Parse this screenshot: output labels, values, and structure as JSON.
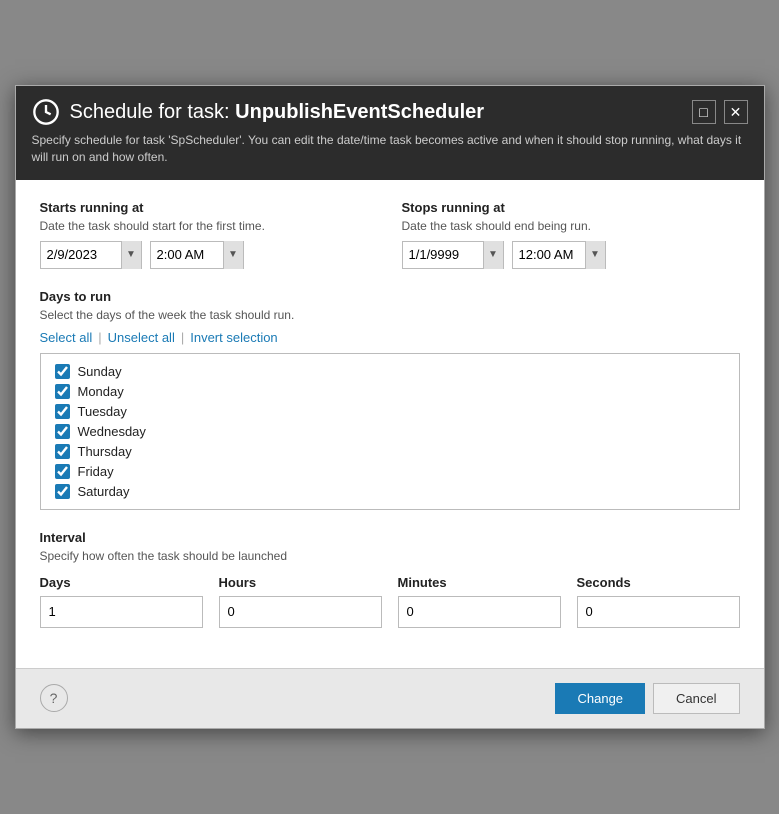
{
  "header": {
    "icon": "clock",
    "title_prefix": "Schedule for task:",
    "task_name": "UnpublishEventScheduler",
    "subtitle": "Specify schedule for task 'SpScheduler'. You can edit the date/time task becomes active and when it should stop running, what days it will run on and how often.",
    "maximize_label": "□",
    "close_label": "✕"
  },
  "starts_running": {
    "label": "Starts running at",
    "desc": "Date the task should start for the first time.",
    "date_value": "2/9/2023",
    "time_value": "2:00 AM"
  },
  "stops_running": {
    "label": "Stops running at",
    "desc": "Date the task should end being run.",
    "date_value": "1/1/9999",
    "time_value": "12:00 AM"
  },
  "days_to_run": {
    "label": "Days to run",
    "desc": "Select the days of the week the task should run.",
    "select_all_label": "Select all",
    "unselect_all_label": "Unselect all",
    "invert_selection_label": "Invert selection",
    "days": [
      {
        "id": "sunday",
        "label": "Sunday",
        "checked": true
      },
      {
        "id": "monday",
        "label": "Monday",
        "checked": true
      },
      {
        "id": "tuesday",
        "label": "Tuesday",
        "checked": true
      },
      {
        "id": "wednesday",
        "label": "Wednesday",
        "checked": true
      },
      {
        "id": "thursday",
        "label": "Thursday",
        "checked": true
      },
      {
        "id": "friday",
        "label": "Friday",
        "checked": true
      },
      {
        "id": "saturday",
        "label": "Saturday",
        "checked": true
      }
    ]
  },
  "interval": {
    "label": "Interval",
    "desc": "Specify how often the task should be launched",
    "fields": [
      {
        "id": "days",
        "label": "Days",
        "value": "1"
      },
      {
        "id": "hours",
        "label": "Hours",
        "value": "0"
      },
      {
        "id": "minutes",
        "label": "Minutes",
        "value": "0"
      },
      {
        "id": "seconds",
        "label": "Seconds",
        "value": "0"
      }
    ]
  },
  "footer": {
    "help_label": "?",
    "change_label": "Change",
    "cancel_label": "Cancel"
  }
}
